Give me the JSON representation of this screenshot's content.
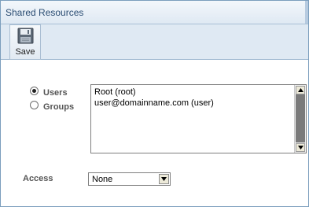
{
  "panel": {
    "title": "Shared Resources"
  },
  "toolbar": {
    "save_label": "Save",
    "save_icon": "floppy-disk-icon"
  },
  "share_type": {
    "options": [
      {
        "label": "Users",
        "checked": true
      },
      {
        "label": "Groups",
        "checked": false
      }
    ]
  },
  "members": {
    "items": [
      "Root (root)",
      "user@domainname.com (user)"
    ]
  },
  "access": {
    "label": "Access",
    "selected": "None"
  },
  "colors": {
    "title_text": "#2a4c72",
    "toolbar_bg": "#dfe9f3",
    "border": "#7b9ebd"
  }
}
